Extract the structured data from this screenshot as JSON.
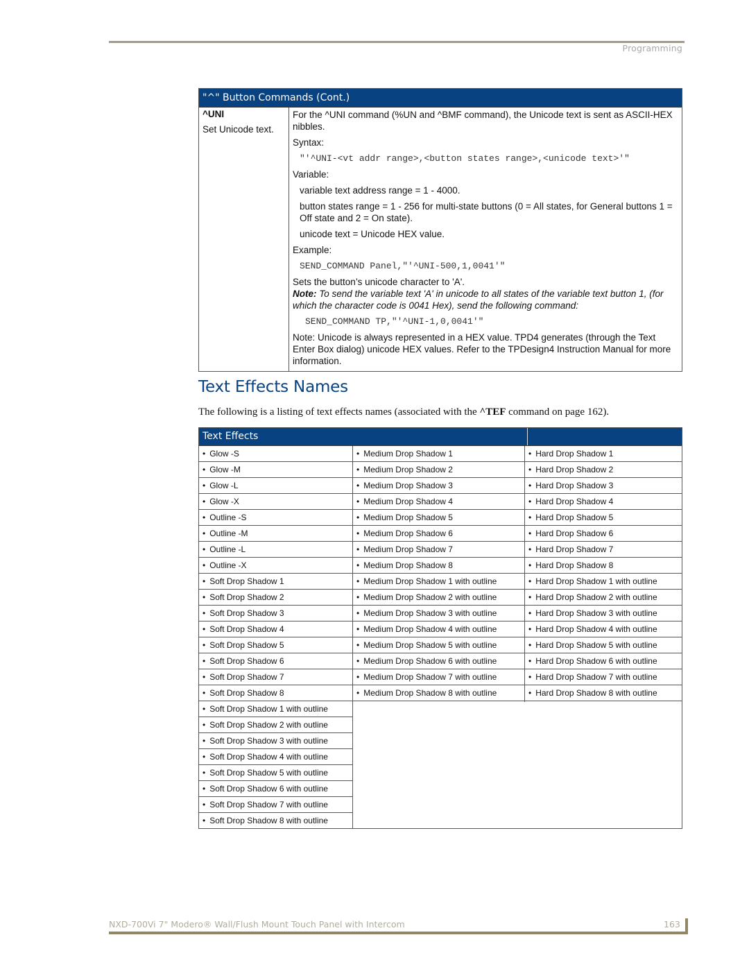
{
  "header": {
    "section": "Programming"
  },
  "command_table": {
    "title": "\"^\" Button Commands (Cont.)",
    "command": "^UNI",
    "command_desc": "Set Unicode text.",
    "intro": "For the ^UNI command (%UN and ^BMF command), the Unicode text is sent as ASCII-HEX nibbles.",
    "syntax_label": "Syntax:",
    "syntax": "\"'^UNI-<vt addr range>,<button states range>,<unicode text>'\"",
    "variable_label": "Variable:",
    "variables": [
      "variable text address range = 1 - 4000.",
      "button states range = 1 - 256 for multi-state buttons (0 = All states, for General buttons 1 = Off state and 2 = On state).",
      "unicode text = Unicode HEX value."
    ],
    "example_label": "Example:",
    "example": "SEND_COMMAND Panel,\"'^UNI-500,1,0041'\"",
    "example_desc": "Sets the button’s unicode character to 'A'.",
    "note_label": "Note:",
    "note_text": " To send the variable text 'A' in unicode to all states of the variable text button 1, (for which the character code is 0041 Hex), send the following command:",
    "note_example": "SEND_COMMAND TP,\"'^UNI-1,0,0041'\"",
    "footer_note": "Note: Unicode is always represented in a HEX value. TPD4 generates (through the Text Enter Box dialog) unicode HEX values. Refer to the TPDesign4 Instruction Manual for more information."
  },
  "section": {
    "heading": "Text Effects Names",
    "intro_before": "The following is a listing of text effects names (associated with the ",
    "intro_bold": "^TEF",
    "intro_after": " command on page 162)."
  },
  "effects_table": {
    "title": "Text Effects",
    "bullet": "•",
    "columns": [
      [
        "Glow -S",
        "Glow -M",
        "Glow -L",
        "Glow -X",
        "Outline -S",
        "Outline -M",
        "Outline -L",
        "Outline -X",
        "Soft Drop Shadow 1",
        "Soft Drop Shadow 2",
        "Soft Drop Shadow 3",
        "Soft Drop Shadow 4",
        "Soft Drop Shadow 5",
        "Soft Drop Shadow 6",
        "Soft Drop Shadow 7",
        "Soft Drop Shadow 8",
        "Soft Drop Shadow 1 with outline",
        "Soft Drop Shadow 2 with outline",
        "Soft Drop Shadow 3 with outline",
        "Soft Drop Shadow 4 with outline",
        "Soft Drop Shadow 5 with outline",
        "Soft Drop Shadow 6 with outline",
        "Soft Drop Shadow 7 with outline",
        "Soft Drop Shadow 8 with outline"
      ],
      [
        "Medium Drop Shadow 1",
        "Medium Drop Shadow 2",
        "Medium Drop Shadow 3",
        "Medium Drop Shadow 4",
        "Medium Drop Shadow 5",
        "Medium Drop Shadow 6",
        "Medium Drop Shadow 7",
        "Medium Drop Shadow 8",
        "Medium Drop Shadow 1 with outline",
        "Medium Drop Shadow 2 with outline",
        "Medium Drop Shadow 3 with outline",
        "Medium Drop Shadow 4 with outline",
        "Medium Drop Shadow 5 with outline",
        "Medium Drop Shadow 6 with outline",
        "Medium Drop Shadow 7 with outline",
        "Medium Drop Shadow 8 with outline"
      ],
      [
        "Hard Drop Shadow 1",
        "Hard Drop Shadow 2",
        "Hard Drop Shadow 3",
        "Hard Drop Shadow 4",
        "Hard Drop Shadow 5",
        "Hard Drop Shadow 6",
        "Hard Drop Shadow 7",
        "Hard Drop Shadow 8",
        "Hard Drop Shadow 1 with outline",
        "Hard Drop Shadow 2 with outline",
        "Hard Drop Shadow 3 with outline",
        "Hard Drop Shadow 4 with outline",
        "Hard Drop Shadow 5 with outline",
        "Hard Drop Shadow 6 with outline",
        "Hard Drop Shadow 7 with outline",
        "Hard Drop Shadow 8 with outline"
      ]
    ]
  },
  "footer": {
    "title": "NXD-700Vi 7\" Modero® Wall/Flush Mount Touch Panel with Intercom",
    "page": "163"
  },
  "colors": {
    "header_blue": "#084280",
    "rule_olive": "#918764",
    "muted_text": "#b0ad9d"
  }
}
